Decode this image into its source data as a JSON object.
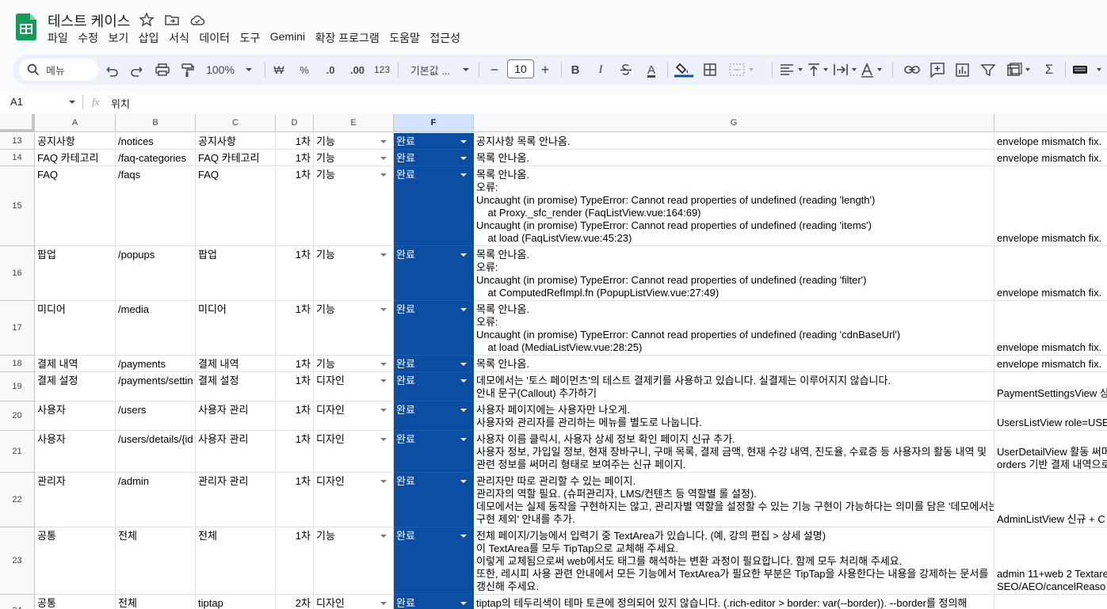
{
  "doc": {
    "title": "테스트 케이스"
  },
  "menu": [
    "파일",
    "수정",
    "보기",
    "삽입",
    "서식",
    "데이터",
    "도구",
    "Gemini",
    "확장 프로그램",
    "도움말",
    "접근성"
  ],
  "toolbar": {
    "search_label": "메뉴",
    "zoom": "100%",
    "currency": "₩",
    "percent": "%",
    "dec_decrease": ".0",
    "dec_increase": ".00",
    "number_format": "123",
    "font_name": "기본값 ...",
    "font_size": "10",
    "minus": "−",
    "plus": "+",
    "bold": "B",
    "italic": "I",
    "text_color": "A"
  },
  "formula_bar": {
    "cell_ref": "A1",
    "fx": "fx",
    "value": "위치"
  },
  "columns": [
    "A",
    "B",
    "C",
    "D",
    "E",
    "F",
    "G"
  ],
  "rows": [
    {
      "num": "13",
      "a": "공지사항",
      "b": "/notices",
      "c": "공지사항",
      "d": "1차",
      "e": "기능",
      "f": "완료",
      "g": "공지사항 목록 안나옴.",
      "h": "envelope mismatch fix."
    },
    {
      "num": "14",
      "a": "FAQ 카테고리",
      "b": "/faq-categories",
      "c": "FAQ 카테고리",
      "d": "1차",
      "e": "기능",
      "f": "완료",
      "g": "목록 안나옴.",
      "h": "envelope mismatch fix."
    },
    {
      "num": "15",
      "a": "FAQ",
      "b": "/faqs",
      "c": "FAQ",
      "d": "1차",
      "e": "기능",
      "f": "완료",
      "g": "목록 안나옴.\n오류:\nUncaught (in promise) TypeError: Cannot read properties of undefined (reading 'length')\n    at Proxy._sfc_render (FaqListView.vue:164:69)\nUncaught (in promise) TypeError: Cannot read properties of undefined (reading 'items')\n    at load (FaqListView.vue:45:23)",
      "h": "envelope mismatch fix."
    },
    {
      "num": "16",
      "a": "팝업",
      "b": "/popups",
      "c": "팝업",
      "d": "1차",
      "e": "기능",
      "f": "완료",
      "g": "목록 안나옴.\n오류:\nUncaught (in promise) TypeError: Cannot read properties of undefined (reading 'filter')\n    at ComputedRefImpl.fn (PopupListView.vue:27:49)",
      "h": "envelope mismatch fix."
    },
    {
      "num": "17",
      "a": "미디어",
      "b": "/media",
      "c": "미디어",
      "d": "1차",
      "e": "기능",
      "f": "완료",
      "g": "목록 안나옴.\n오류:\nUncaught (in promise) TypeError: Cannot read properties of undefined (reading 'cdnBaseUrl')\n    at load (MediaListView.vue:28:25)",
      "h": "envelope mismatch fix."
    },
    {
      "num": "18",
      "a": "결제 내역",
      "b": "/payments",
      "c": "결제 내역",
      "d": "1차",
      "e": "기능",
      "f": "완료",
      "g": "목록 안나옴.",
      "h": "envelope mismatch fix."
    },
    {
      "num": "19",
      "a": "결제 설정",
      "b": "/payments/settin",
      "c": "결제 설정",
      "d": "1차",
      "e": "디자인",
      "f": "완료",
      "g": "데모에서는 '토스 페이먼츠'의 테스트 결제키를 사용하고 있습니다. 실결제는 이루어지지 않습니다.\n안내 문구(Callout) 추가하기",
      "h": "PaymentSettingsView 상"
    },
    {
      "num": "20",
      "a": "사용자",
      "b": "/users",
      "c": "사용자 관리",
      "d": "1차",
      "e": "디자인",
      "f": "완료",
      "g": "사용자 페이지에는 사용자만 나오게.\n사용자와 관리자를 관리하는 메뉴를 별도로 나눕니다.",
      "h": "UsersListView role=USE"
    },
    {
      "num": "21",
      "a": "사용자",
      "b": "/users/details/{id",
      "c": "사용자 관리",
      "d": "1차",
      "e": "디자인",
      "f": "완료",
      "g": "사용자 이름 클릭시, 사용자 상세 정보 확인 페이지 신규 추가.\n사용자 정보, 가입일 정보, 현재 장바구니, 구매 목록, 결제 금액, 현재 수강 내역, 진도율, 수료증 등 사용자의 활동 내역 및\n관련 정보를 써머리 형태로 보여주는 신규 페이지.",
      "h": "UserDetailView 활동 써머\norders 기반 결제 내역으로"
    },
    {
      "num": "22",
      "a": "관리자",
      "b": "/admin",
      "c": "관리자 관리",
      "d": "1차",
      "e": "디자인",
      "f": "완료",
      "g": "관리자만 따로 관리할 수 있는 페이지.\n관리자의 역할 필요. (슈퍼관리자, LMS/컨텐츠 등 역할별 롤 설정).\n데모에서는 실제 동작을 구현하지는 않고, 관리자별 역할을 설정할 수 있는 기능 구현이 가능하다는 의미를 담은 '데모에서는\n구현 제외' 안내를 추가.",
      "h": "AdminListView 신규 + C"
    },
    {
      "num": "23",
      "a": "공통",
      "b": "전체",
      "c": "전체",
      "d": "1차",
      "e": "기능",
      "f": "완료",
      "g": "전체 페이지/기능에서 입력기 중 TextArea가 있습니다. (예, 강의 편집 > 상세 설명)\n이 TextArea를 모두 TipTap으로 교체해 주세요.\n이렇게 교체됨으로써 web에서도 태그를 해석하는 변환 과정이 필요합니다. 함께 모두 처리해 주세요.\n또한, 레시피 사용 관련 안내에서 모든 기능에서 TextArea가 필요한 부분은 TipTap을 사용한다는 내용을 강제하는 문서를\n갱신해 주세요.",
      "h": "admin 11+web 2 Textare\nSEO/AEO/cancelReaso"
    },
    {
      "num": "24",
      "a": "공통",
      "b": "전체",
      "c": "tiptap",
      "d": "2차",
      "e": "디자인",
      "f": "완료",
      "g": "tiptap의 테두리색이 테마 토큰에 정의되어 있지 않습니다. (.rich-editor > border: var(--border)). --border를 정의해",
      "h": ""
    }
  ]
}
